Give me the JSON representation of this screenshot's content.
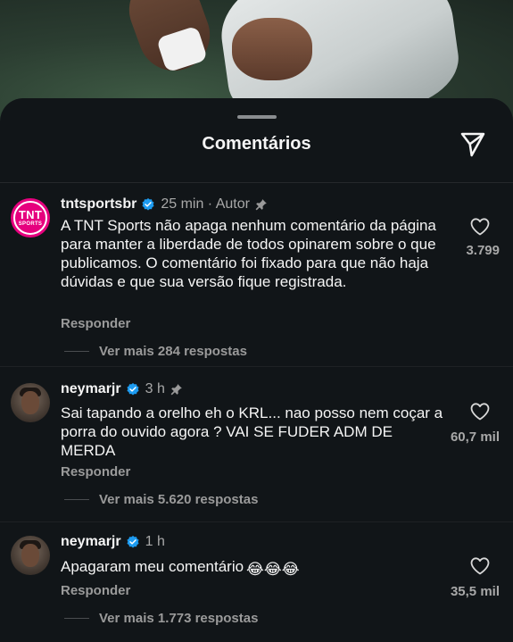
{
  "sheet": {
    "title": "Comentários"
  },
  "colors": {
    "accent": "#1d9bf0",
    "tnt_brand": "#e6007e",
    "sheet_bg": "#111518"
  },
  "comments": [
    {
      "username": "tntsportsbr",
      "verified": true,
      "time": "25 min · Autor",
      "pinned": true,
      "avatar_text_big": "TNT",
      "avatar_text_small": "SPORTS",
      "text": "A TNT Sports não apaga nenhum comentário da página para manter a liberdade de todos opinarem sobre o que publicamos. O comentário foi fixado para que não haja dúvidas e que sua versão fique registrada.",
      "likes": "3.799",
      "reply_label": "Responder",
      "more_replies": "Ver mais 284 respostas"
    },
    {
      "username": "neymarjr",
      "verified": true,
      "time": "3 h",
      "pinned": true,
      "text": "Sai tapando a orelho eh o KRL... nao posso nem coçar a porra do ouvido agora ? VAI SE FUDER ADM DE MERDA",
      "likes": "60,7 mil",
      "reply_label": "Responder",
      "more_replies": "Ver mais 5.620 respostas"
    },
    {
      "username": "neymarjr",
      "verified": true,
      "time": "1 h",
      "pinned": false,
      "text": "Apagaram meu comentário",
      "emoji": "😂😂😂",
      "likes": "35,5 mil",
      "reply_label": "Responder",
      "more_replies": "Ver mais 1.773 respostas"
    }
  ],
  "icons": {
    "share": "send-icon",
    "like": "heart-outline-icon",
    "verified": "verified-badge-icon",
    "pin": "pin-icon"
  }
}
